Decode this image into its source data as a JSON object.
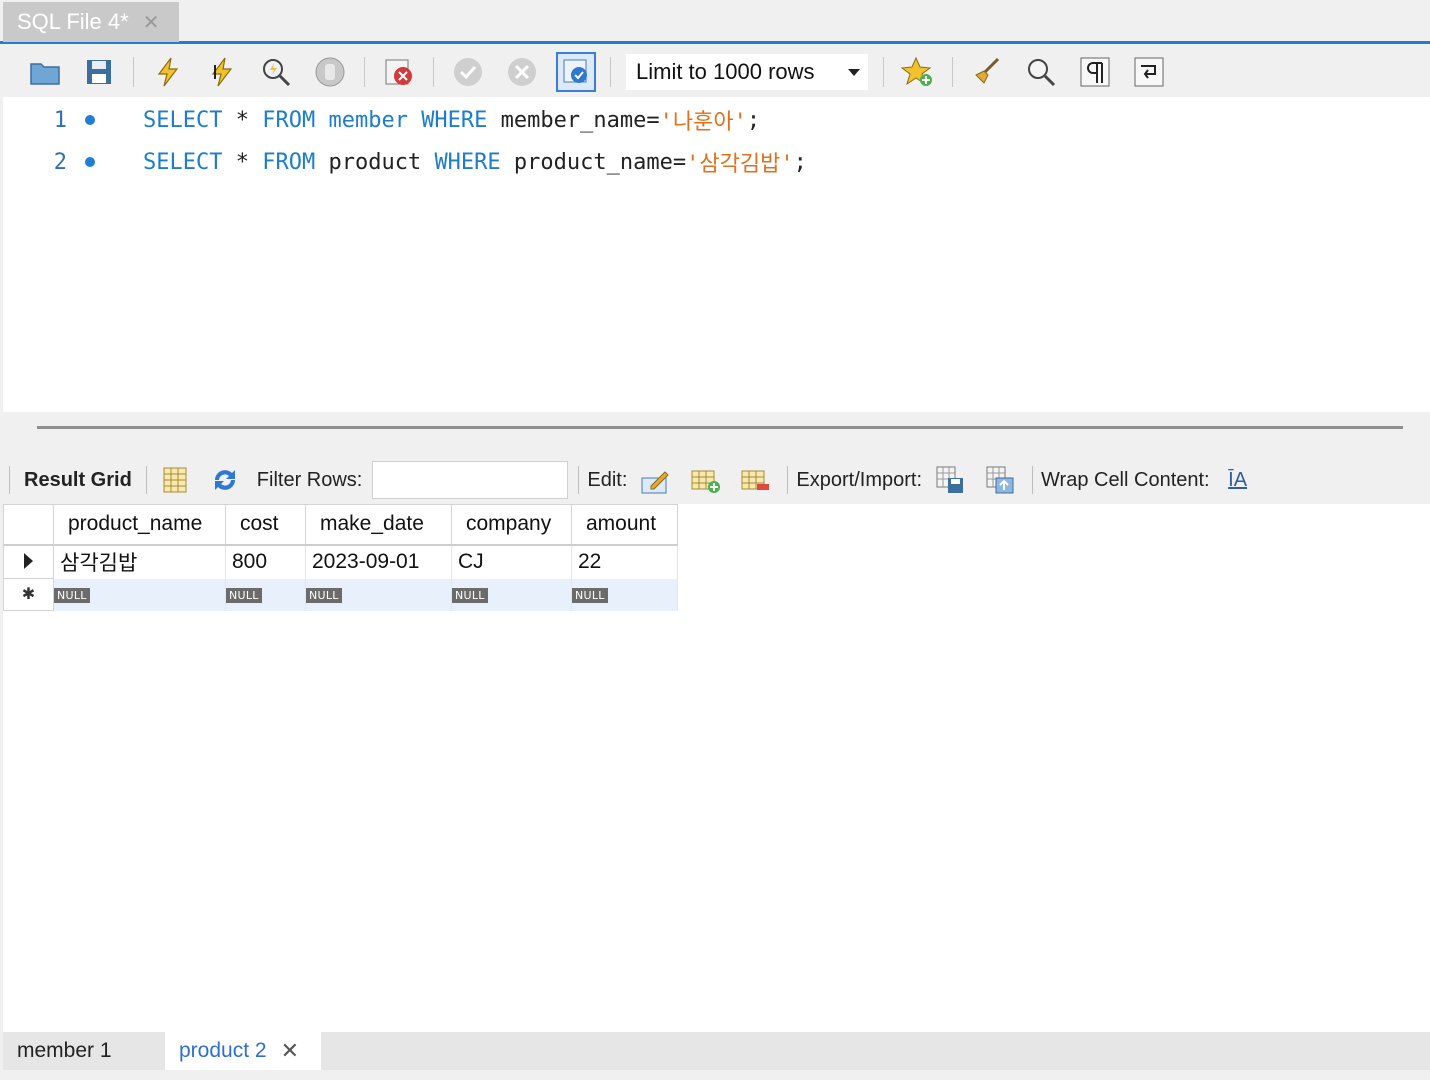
{
  "file_tab": {
    "title": "SQL File 4*",
    "close": "✕"
  },
  "toolbar": {
    "limit_label": "Limit to 1000 rows"
  },
  "editor": {
    "lines": [
      {
        "num": "1",
        "kw1": "SELECT",
        "op": " * ",
        "kw2": "FROM",
        "table": " member ",
        "kw3": "WHERE",
        "col": " member_name=",
        "str": "'나훈아'",
        "end": ";"
      },
      {
        "num": "2",
        "kw1": "SELECT",
        "op": " * ",
        "kw2": "FROM",
        "table": " product ",
        "kw3": "WHERE",
        "col": " product_name=",
        "str": "'삼각김밥'",
        "end": ";"
      }
    ]
  },
  "result_toolbar": {
    "result_grid": "Result Grid",
    "filter_rows": "Filter Rows:",
    "edit": "Edit:",
    "export_import": "Export/Import:",
    "wrap": "Wrap Cell Content:",
    "wrap_icon_text": "ĪA"
  },
  "grid": {
    "columns": [
      "product_name",
      "cost",
      "make_date",
      "company",
      "amount"
    ],
    "rows": [
      [
        "삼각김밥",
        "800",
        "2023-09-01",
        "CJ",
        "22"
      ]
    ],
    "null_label": "NULL",
    "new_row_marker": "✱"
  },
  "bottom_tabs": {
    "tab1": "member 1",
    "tab2": "product 2",
    "close": "✕"
  },
  "colors": {
    "accent": "#1e7fd4",
    "keyword": "#1d7dcc",
    "string": "#e0701a"
  }
}
